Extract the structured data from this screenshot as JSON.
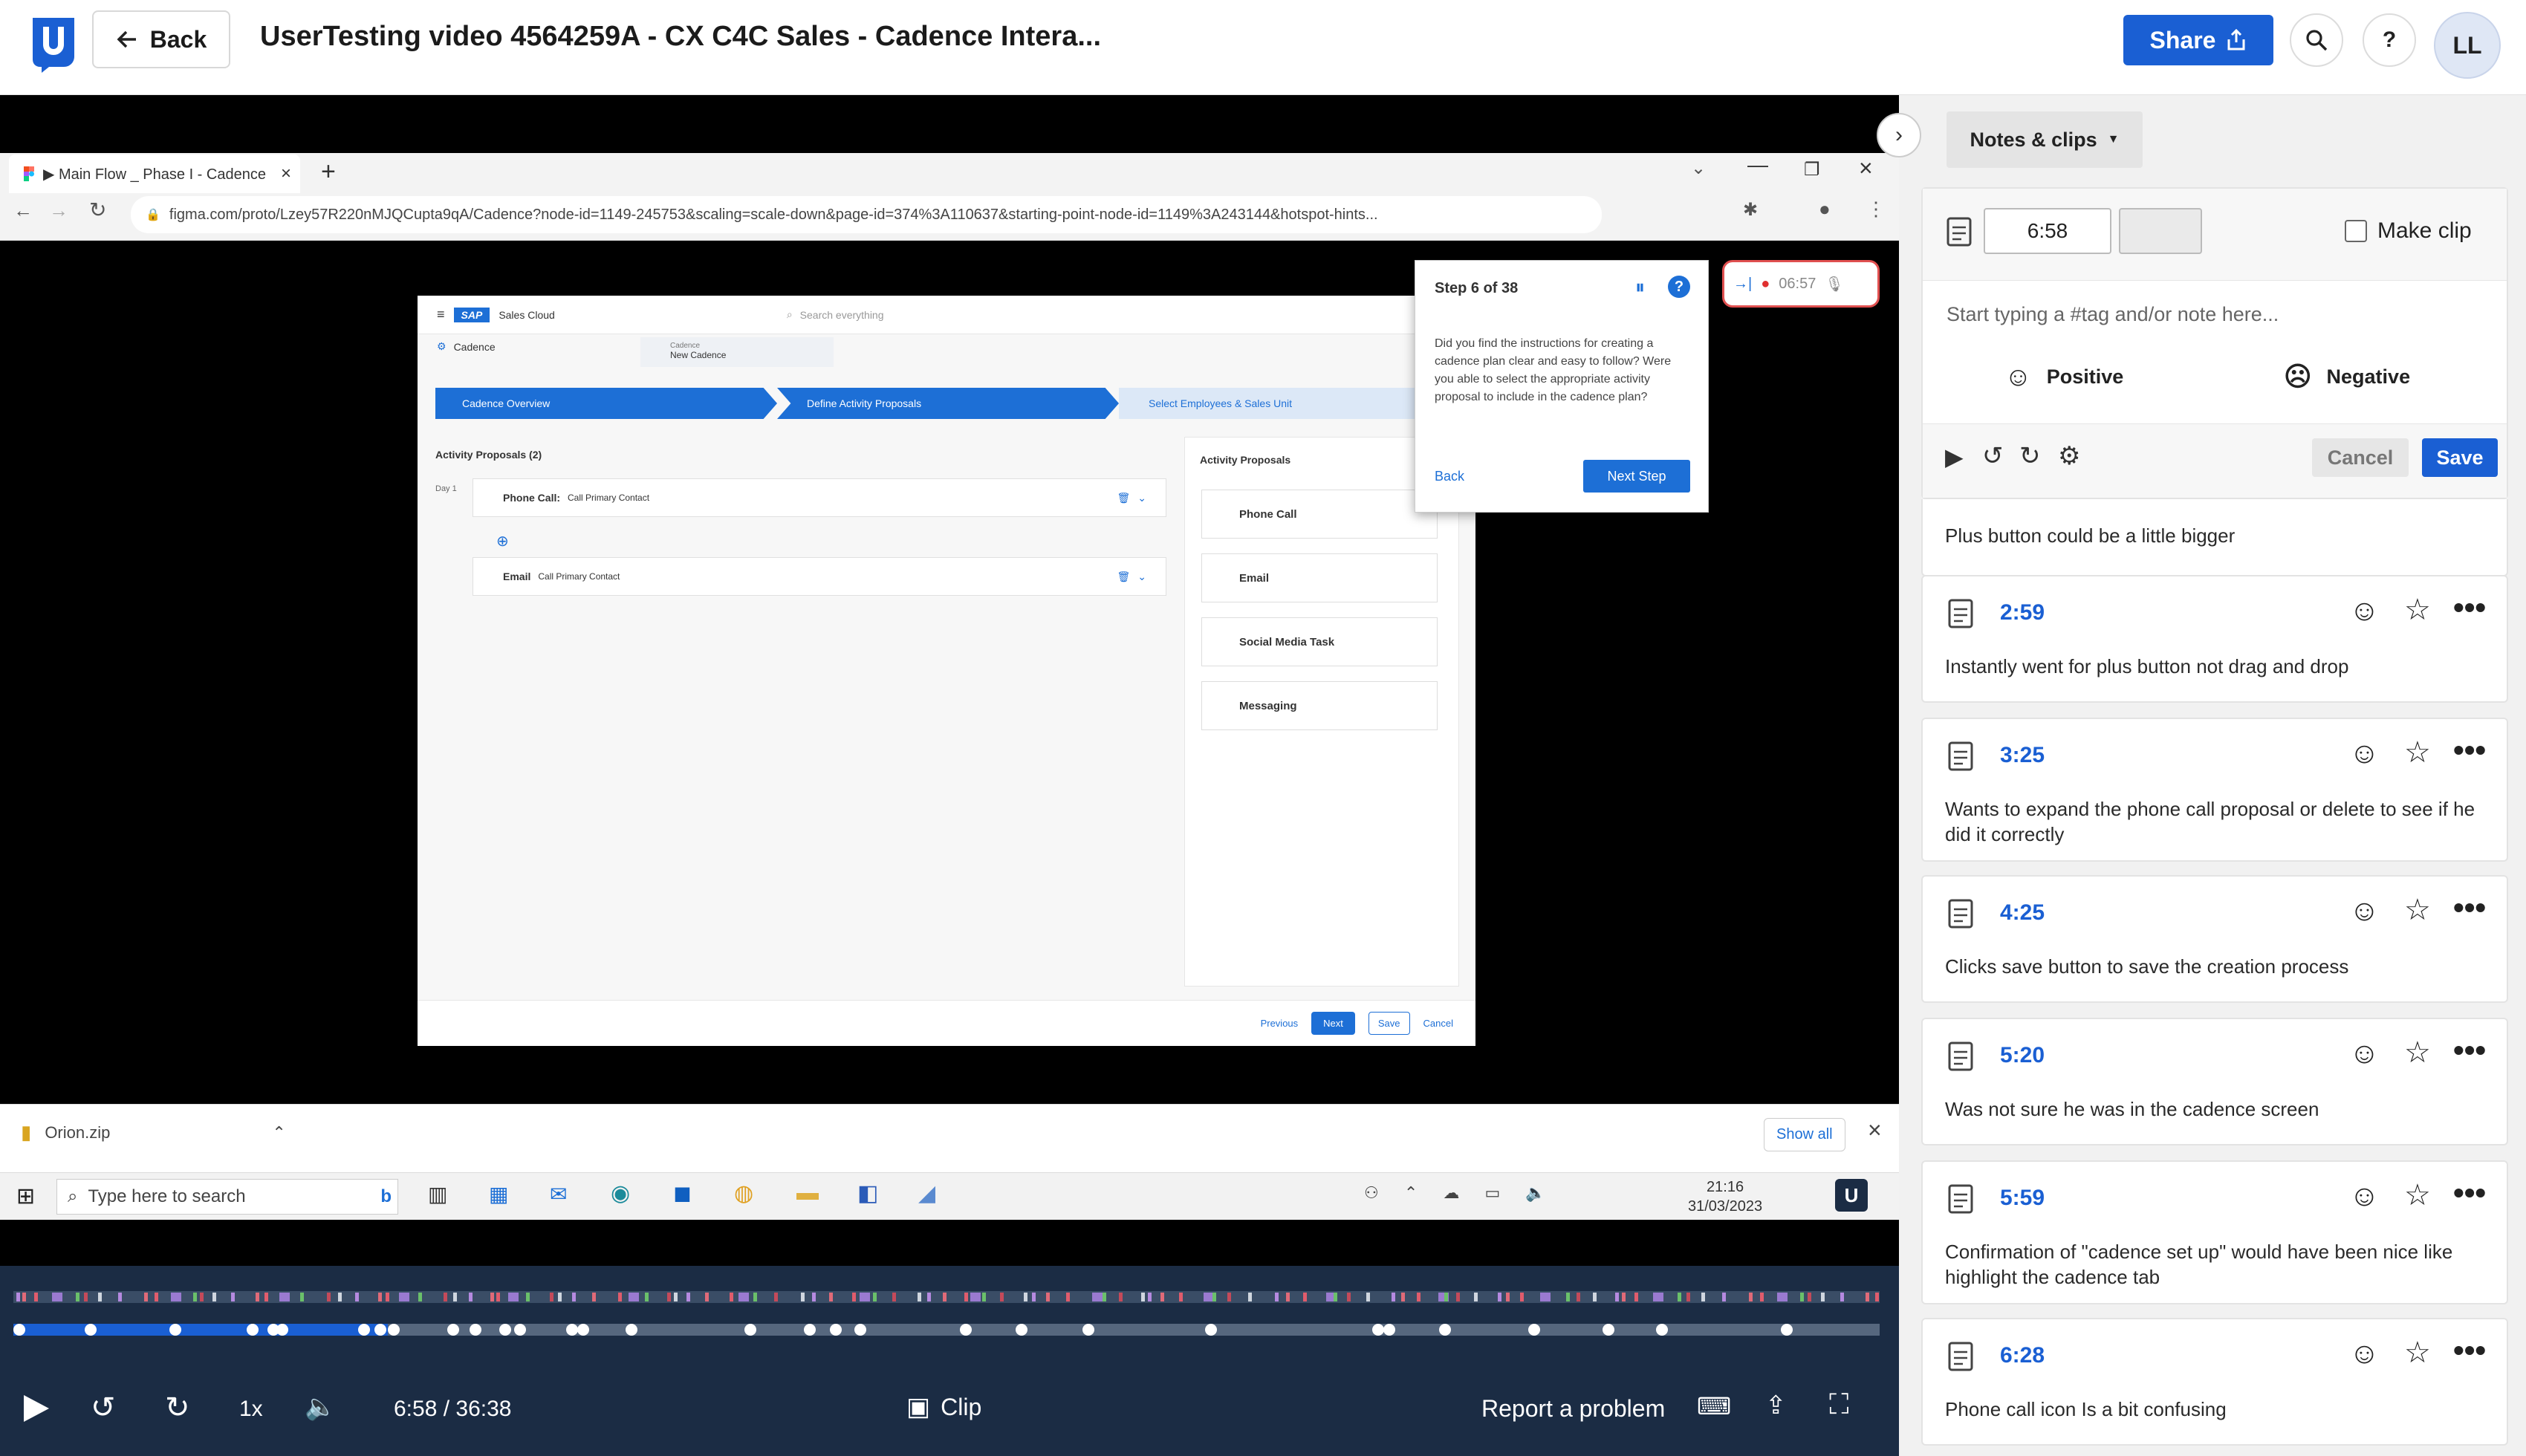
{
  "header": {
    "back_label": "Back",
    "title": "UserTesting video 4564259A - CX C4C Sales - Cadence Intera...",
    "share_label": "Share",
    "help_label": "?",
    "avatar_initials": "LL"
  },
  "browser": {
    "tab_title": "▶ Main Flow _ Phase I - Cadence",
    "url": "figma.com/proto/Lzey57R220nMJQCupta9qA/Cadence?node-id=1149-245753&scaling=scale-down&page-id=374%3A110637&starting-point-node-id=1149%3A243144&hotspot-hints..."
  },
  "app": {
    "brand": "SAP",
    "product": "Sales Cloud",
    "search_placeholder": "Search everything",
    "breadcrumb_1": "Cadence",
    "breadcrumb_2_small": "Cadence",
    "breadcrumb_2": "New Cadence",
    "steps": [
      "Cadence Overview",
      "Define Activity Proposals",
      "Select Employees & Sales Unit"
    ],
    "proposals_title": "Activity Proposals (2)",
    "day_label": "Day 1",
    "items": [
      {
        "type": "Phone Call:",
        "detail": "Call Primary Contact"
      },
      {
        "type": "Email",
        "detail": "Call Primary Contact"
      }
    ],
    "right_title": "Activity Proposals",
    "right_items": [
      "Phone Call",
      "Email",
      "Social Media Task",
      "Messaging"
    ],
    "footer": {
      "previous": "Previous",
      "next": "Next",
      "save": "Save",
      "cancel": "Cancel"
    }
  },
  "study_popup": {
    "step": "Step 6 of 38",
    "text": "Did you find the instructions for creating a cadence plan clear and easy to follow? Were you able to select the appropriate activity proposal to include in the cadence plan?",
    "back": "Back",
    "next": "Next Step",
    "rec_time": "06:57"
  },
  "downloads": {
    "file": "Orion.zip",
    "show_all": "Show all"
  },
  "taskbar": {
    "search_placeholder": "Type here to search",
    "time": "21:16",
    "date": "31/03/2023"
  },
  "player": {
    "speed": "1x",
    "time": "6:58 / 36:38",
    "clip_label": "Clip",
    "report_label": "Report a problem"
  },
  "notes_panel": {
    "dropdown_label": "Notes & clips",
    "time_value": "6:58",
    "make_clip_label": "Make clip",
    "note_placeholder": "Start typing a #tag and/or note here...",
    "positive_label": "Positive",
    "negative_label": "Negative",
    "cancel_label": "Cancel",
    "save_label": "Save",
    "partial_note": "Plus button could be a little bigger",
    "notes": [
      {
        "time": "2:59",
        "text": "Instantly went for plus button not drag and drop"
      },
      {
        "time": "3:25",
        "text": "Wants to expand the phone call proposal or delete to see if he did it correctly"
      },
      {
        "time": "4:25",
        "text": "Clicks save button to save the creation process"
      },
      {
        "time": "5:20",
        "text": "Was not sure he was in the cadence screen"
      },
      {
        "time": "5:59",
        "text": "Confirmation of \"cadence set up\" would have been nice like highlight the cadence tab"
      },
      {
        "time": "6:28",
        "text": "Phone call icon Is a bit confusing"
      }
    ]
  },
  "colors": {
    "accent": "#1a5fd3",
    "player_bg": "#1b2c44",
    "panel_bg": "#f1f1f1"
  }
}
